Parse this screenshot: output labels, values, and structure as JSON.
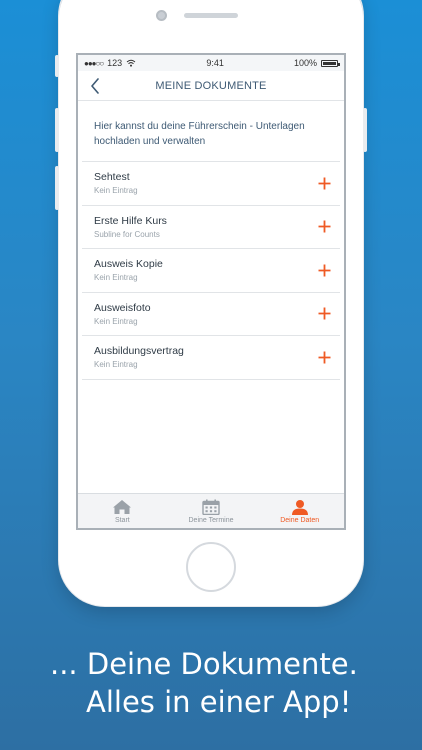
{
  "status_bar": {
    "carrier": "123",
    "time": "9:41",
    "battery": "100%"
  },
  "navbar": {
    "title": "MEINE DOKUMENTE",
    "back_icon": "chevron-left-icon"
  },
  "intro_text": "Hier kannst du deine Führerschein - Unterlagen hochladen und verwalten",
  "documents": [
    {
      "title": "Sehtest",
      "subtitle": "Kein Eintrag"
    },
    {
      "title": "Erste Hilfe Kurs",
      "subtitle": "Subline for Counts"
    },
    {
      "title": "Ausweis Kopie",
      "subtitle": "Kein Eintrag"
    },
    {
      "title": "Ausweisfoto",
      "subtitle": "Kein Eintrag"
    },
    {
      "title": "Ausbildungsvertrag",
      "subtitle": "Kein Eintrag"
    }
  ],
  "tabs": [
    {
      "label": "Start",
      "icon": "home-icon",
      "active": false
    },
    {
      "label": "Deine Termine",
      "icon": "calendar-icon",
      "active": false
    },
    {
      "label": "Deine Daten",
      "icon": "user-icon",
      "active": true
    }
  ],
  "caption": {
    "line1": "... Deine Dokumente.",
    "line2": "Alles in einer App!"
  },
  "colors": {
    "accent": "#ef5a24",
    "title_text": "#3e5a74",
    "background_top": "#1b8fd6",
    "background_bottom": "#2d6fa3"
  }
}
